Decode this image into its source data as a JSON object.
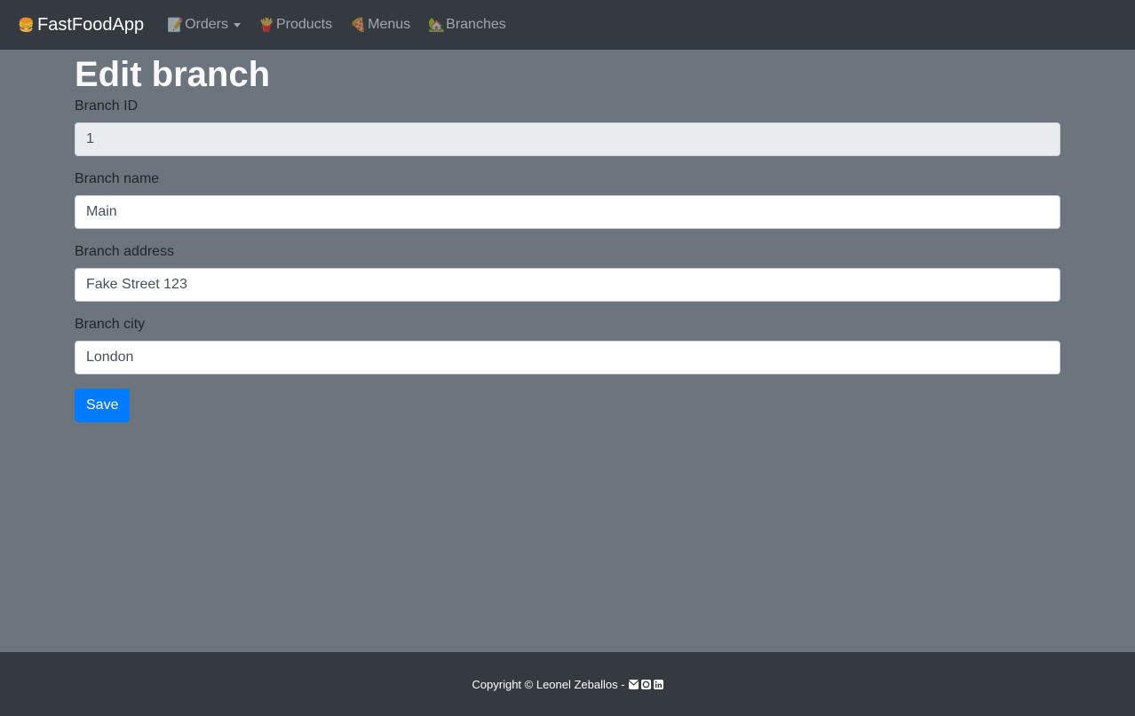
{
  "navbar": {
    "brand_icon": "burger-icon",
    "brand_label": "FastFoodApp",
    "items": [
      {
        "icon": "memo-icon",
        "label": "Orders",
        "dropdown": true
      },
      {
        "icon": "fries-icon",
        "label": "Products"
      },
      {
        "icon": "pizza-icon",
        "label": "Menus"
      },
      {
        "icon": "house-icon",
        "label": "Branches"
      }
    ]
  },
  "page": {
    "title": "Edit branch"
  },
  "form": {
    "branch_id": {
      "label": "Branch ID",
      "value": "1"
    },
    "branch_name": {
      "label": "Branch name",
      "value": "Main"
    },
    "branch_address": {
      "label": "Branch address",
      "value": "Fake Street 123"
    },
    "branch_city": {
      "label": "Branch city",
      "value": "London"
    },
    "save_label": "Save"
  },
  "footer": {
    "text": "Copyright © Leonel Zeballos -",
    "icons": [
      "envelope-icon",
      "github-icon",
      "linkedin-icon"
    ]
  },
  "colors": {
    "navbar_bg": "#343a40",
    "page_bg": "#6c757d",
    "primary": "#007bff"
  }
}
